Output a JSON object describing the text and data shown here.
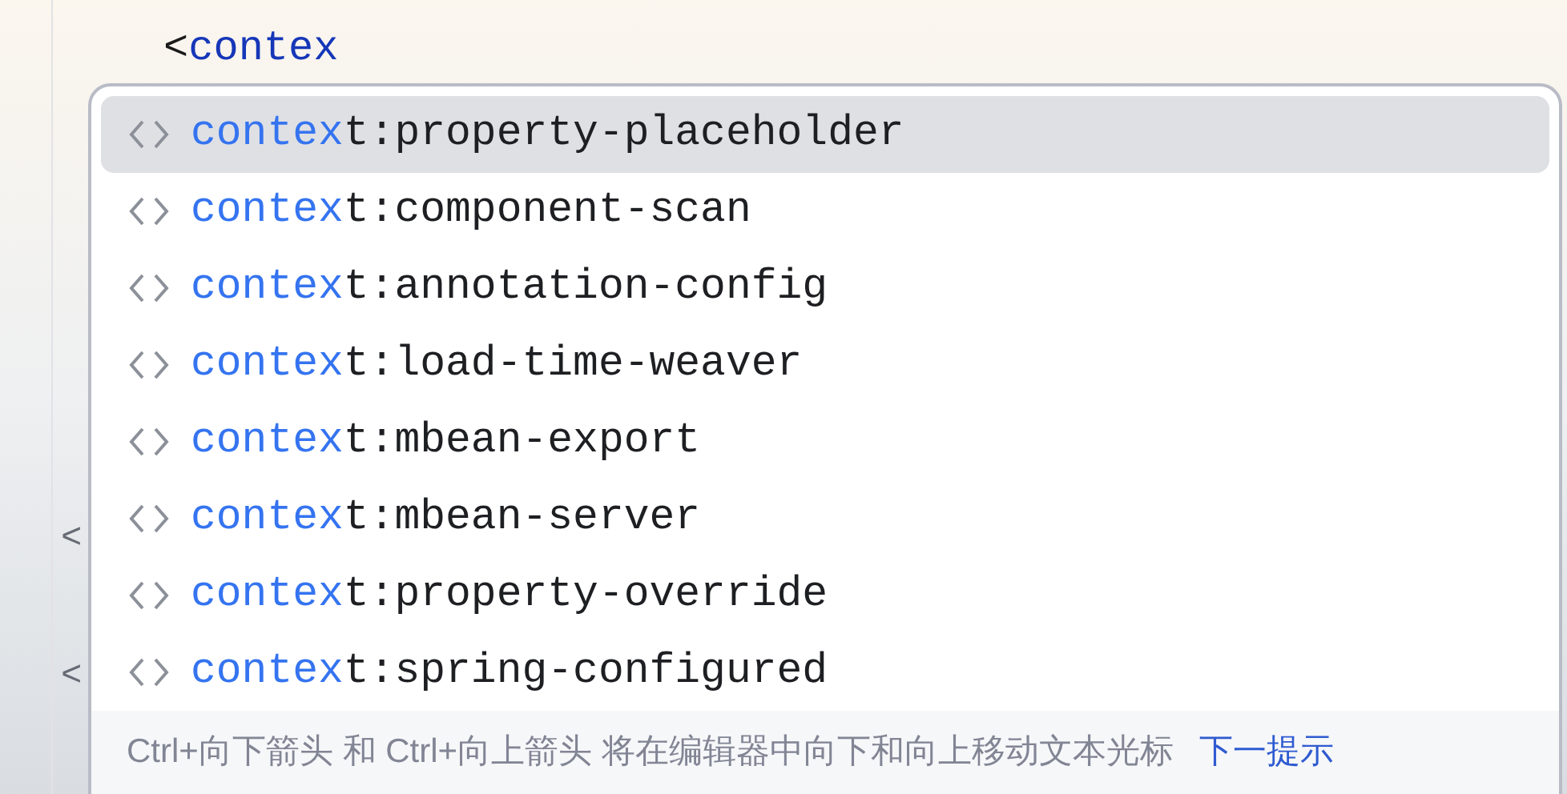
{
  "editor": {
    "tag_open": "<",
    "typed": "contex",
    "gutter_marks": [
      "<",
      "<"
    ]
  },
  "completion_popup": {
    "items": [
      {
        "match": "contex",
        "rest": "t:property-placeholder",
        "selected": true
      },
      {
        "match": "contex",
        "rest": "t:component-scan",
        "selected": false
      },
      {
        "match": "contex",
        "rest": "t:annotation-config",
        "selected": false
      },
      {
        "match": "contex",
        "rest": "t:load-time-weaver",
        "selected": false
      },
      {
        "match": "contex",
        "rest": "t:mbean-export",
        "selected": false
      },
      {
        "match": "contex",
        "rest": "t:mbean-server",
        "selected": false
      },
      {
        "match": "contex",
        "rest": "t:property-override",
        "selected": false
      },
      {
        "match": "contex",
        "rest": "t:spring-configured",
        "selected": false
      }
    ],
    "footer": {
      "hint": "Ctrl+向下箭头 和 Ctrl+向上箭头 将在编辑器中向下和向上移动文本光标",
      "link": "下一提示"
    }
  }
}
